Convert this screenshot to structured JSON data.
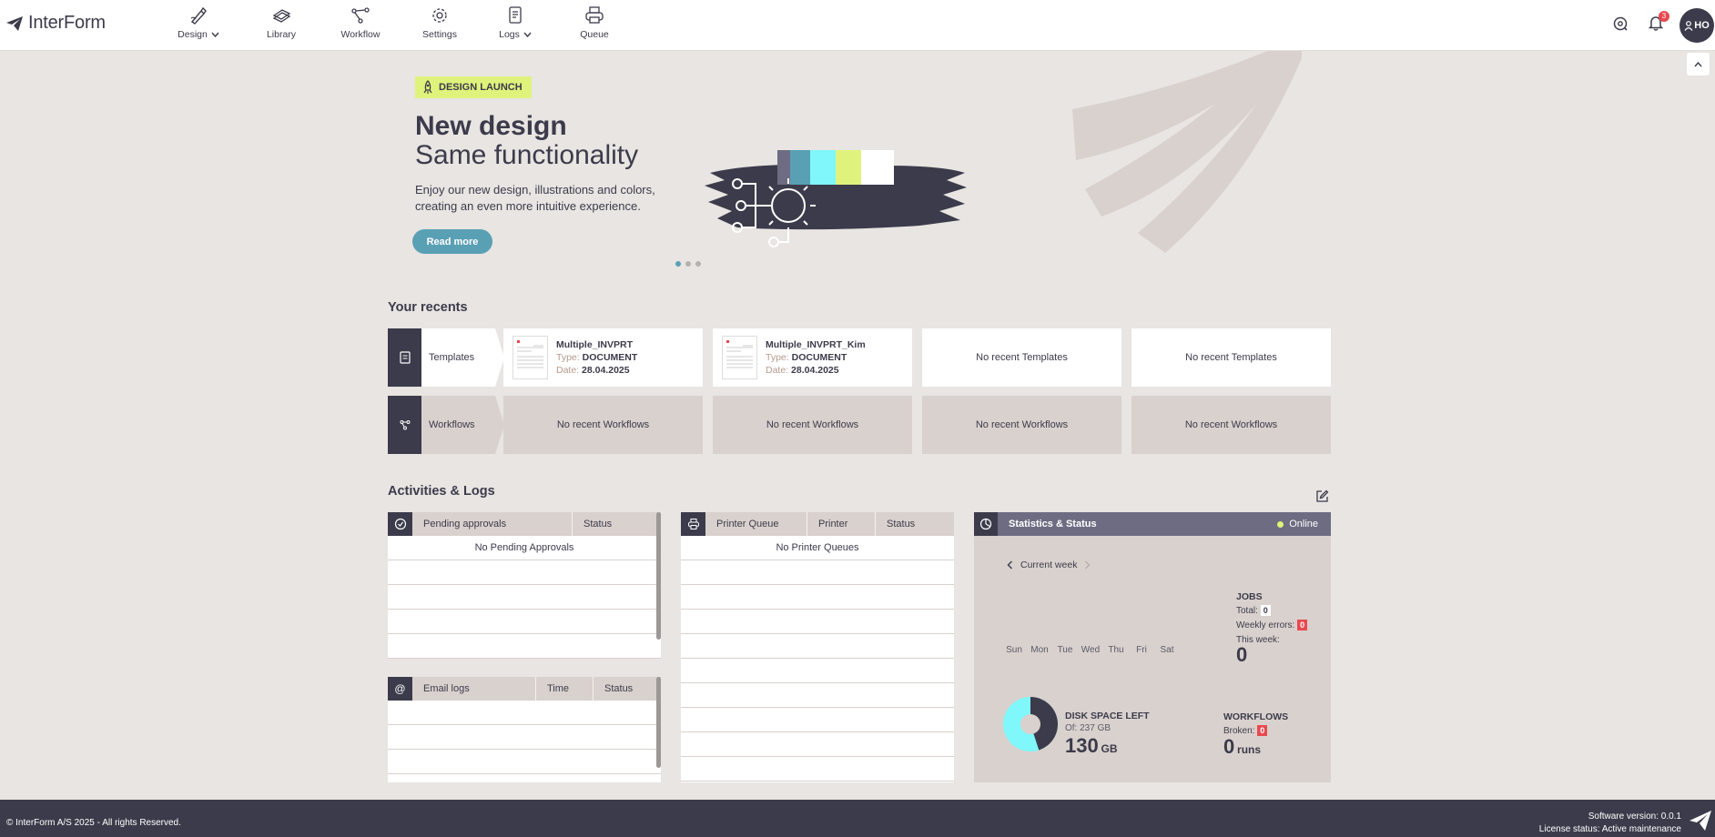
{
  "app": {
    "name": "InterForm"
  },
  "nav": [
    {
      "label": "Design",
      "icon": "design-icon",
      "dropdown": true
    },
    {
      "label": "Library",
      "icon": "library-icon",
      "dropdown": false
    },
    {
      "label": "Workflow",
      "icon": "workflow-icon",
      "dropdown": false
    },
    {
      "label": "Settings",
      "icon": "settings-icon",
      "dropdown": false
    },
    {
      "label": "Logs",
      "icon": "logs-icon",
      "dropdown": true
    },
    {
      "label": "Queue",
      "icon": "printer-icon",
      "dropdown": false
    }
  ],
  "header": {
    "notification_count": "3",
    "avatar_initials": "HO"
  },
  "banner": {
    "tag": "DESIGN LAUNCH",
    "title": "New design",
    "subtitle": "Same functionality",
    "description": "Enjoy our new design, illustrations and colors, creating an even more intuitive experience.",
    "button": "Read more",
    "slides": 3,
    "active_slide": 1
  },
  "recents": {
    "title": "Your recents",
    "templates_label": "Templates",
    "workflows_label": "Workflows",
    "templates": [
      {
        "name": "Multiple_INVPRT",
        "type": "DOCUMENT",
        "date": "28.04.2025"
      },
      {
        "name": "Multiple_INVPRT_Kim",
        "type": "DOCUMENT",
        "date": "28.04.2025"
      }
    ],
    "type_key": "Type:",
    "date_key": "Date:",
    "empty_templates": "No recent Templates",
    "empty_workflows": "No recent Workflows"
  },
  "activities": {
    "title": "Activities & Logs",
    "approvals": {
      "col1": "Pending approvals",
      "col2": "Status",
      "empty": "No Pending Approvals"
    },
    "printer": {
      "col1": "Printer Queue",
      "col2": "Printer",
      "col3": "Status",
      "empty": "No Printer Queues"
    },
    "email": {
      "col1": "Email logs",
      "col2": "Time",
      "col3": "Status"
    }
  },
  "stats": {
    "title": "Statistics & Status",
    "status": "Online",
    "period": "Current week",
    "days": [
      "Sun",
      "Mon",
      "Tue",
      "Wed",
      "Thu",
      "Fri",
      "Sat"
    ],
    "jobs": {
      "label": "JOBS",
      "total_label": "Total:",
      "total": "0",
      "errors_label": "Weekly errors:",
      "errors": "0",
      "week_label": "This week:",
      "week": "0"
    },
    "disk": {
      "label": "DISK SPACE LEFT",
      "of_label": "Of: 237 GB",
      "value": "130",
      "unit": "GB",
      "used_fraction": 0.45
    },
    "workflows": {
      "label": "WORKFLOWS",
      "broken_label": "Broken:",
      "broken": "0",
      "runs": "0",
      "runs_unit": "runs"
    }
  },
  "footer": {
    "copyright": "© InterForm A/S 2025 - All rights Reserved.",
    "version": "Software version: 0.0.1",
    "license": "License status: Active maintenance"
  },
  "colors": {
    "dark": "#3c3b4b",
    "accent": "#5aa0b4",
    "lime": "#dff37c",
    "cyan": "#7ff7fb",
    "error": "#e8494f",
    "bg": "#e8e5e2"
  }
}
